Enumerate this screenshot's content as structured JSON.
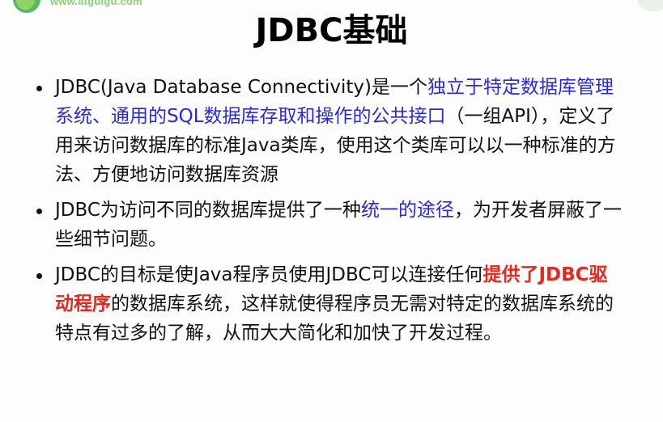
{
  "header": {
    "url_text": "www.atguigu.com"
  },
  "slide": {
    "title": "JDBC基础"
  },
  "bullets": [
    {
      "segments": [
        {
          "text": "JDBC(Java Database Connectivity)是一个",
          "style": "normal"
        },
        {
          "text": "独立于特定数据库管理系统、通用的SQL数据库存取和操作的公共接口",
          "style": "blue"
        },
        {
          "text": "（一组API），定义了用来访问数据库的标准Java类库，使用这个类库可以以一种标准的方法、方便地访问数据库资源",
          "style": "normal"
        }
      ]
    },
    {
      "segments": [
        {
          "text": "JDBC为访问不同的数据库提供了一种",
          "style": "normal"
        },
        {
          "text": "统一的途径",
          "style": "blue"
        },
        {
          "text": "，为开发者屏蔽了一些细节问题。",
          "style": "normal"
        }
      ]
    },
    {
      "segments": [
        {
          "text": "JDBC的目标是使Java程序员使用JDBC可以连接任何",
          "style": "normal"
        },
        {
          "text": "提供了JDBC驱动程序",
          "style": "red"
        },
        {
          "text": "的数据库系统，这样就使得程序员无需对特定的数据库系统的特点有过多的了解，从而大大简化和加快了开发过程。",
          "style": "normal"
        }
      ]
    }
  ],
  "colors": {
    "title": "#000000",
    "text": "#111111",
    "highlight_blue": "#2a2ad1",
    "highlight_red": "#e2281f"
  }
}
